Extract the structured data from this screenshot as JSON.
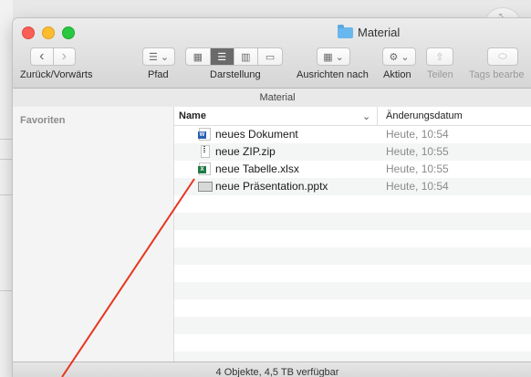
{
  "window": {
    "title": "Material"
  },
  "toolbar": {
    "back_forward_label": "Zurück/Vorwärts",
    "path_label": "Pfad",
    "view_label": "Darstellung",
    "arrange_label": "Ausrichten nach",
    "action_label": "Aktion",
    "share_label": "Teilen",
    "tags_label": "Tags bearbe",
    "back_glyph": "‹",
    "forward_glyph": "›",
    "dropdown_glyph": "⌄"
  },
  "pathbar": {
    "text": "Material"
  },
  "sidebar": {
    "heading": "Favoriten"
  },
  "list": {
    "columns": {
      "name": "Name",
      "date": "Änderungsdatum"
    },
    "files": [
      {
        "name": "neues Dokument",
        "date": "Heute, 10:54",
        "icon": "word-document-icon"
      },
      {
        "name": "neue ZIP.zip",
        "date": "Heute, 10:55",
        "icon": "zip-file-icon"
      },
      {
        "name": "neue Tabelle.xlsx",
        "date": "Heute, 10:55",
        "icon": "excel-file-icon"
      },
      {
        "name": "neue Präsentation.pptx",
        "date": "Heute, 10:54",
        "icon": "presentation-file-icon"
      }
    ]
  },
  "status": {
    "text": "4 Objekte, 4,5 TB verfügbar"
  },
  "annotation": {
    "color": "#e8351f"
  }
}
